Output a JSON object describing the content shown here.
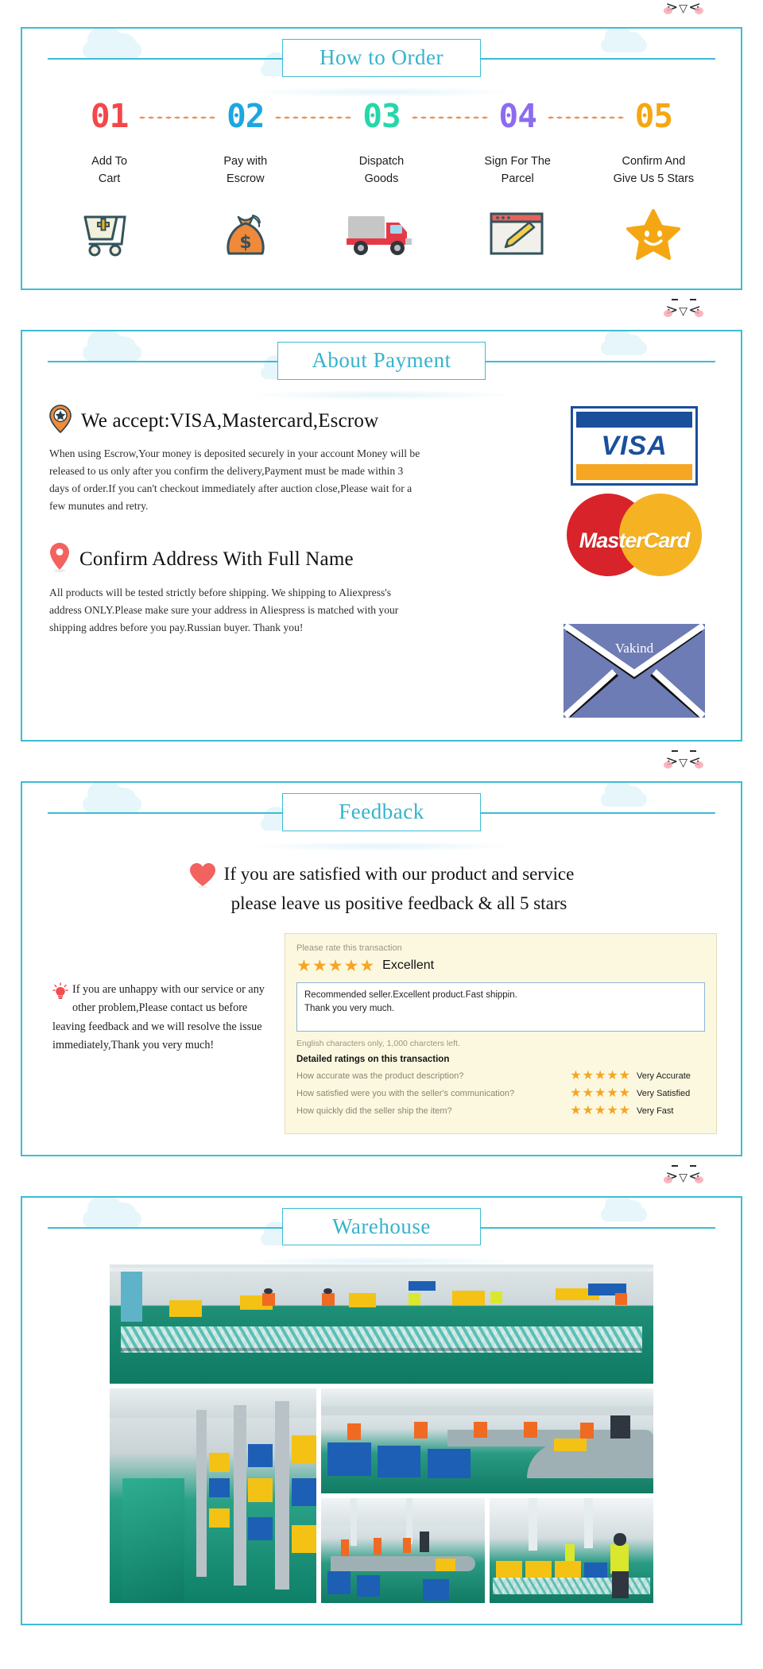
{
  "kaomoji": "⋛⋋ ⋌⋚",
  "sections": {
    "order": {
      "title": "How to Order",
      "steps": [
        {
          "num": "01",
          "color": "#f2484b",
          "label": "Add To\nCart",
          "icon": "shopping-cart-icon"
        },
        {
          "num": "02",
          "color": "#1ca7e0",
          "label": "Pay with\nEscrow",
          "icon": "money-bag-icon"
        },
        {
          "num": "03",
          "color": "#27d6ab",
          "label": "Dispatch\nGoods",
          "icon": "delivery-truck-icon"
        },
        {
          "num": "04",
          "color": "#8b6cf0",
          "label": "Sign For The\nParcel",
          "icon": "sign-document-icon"
        },
        {
          "num": "05",
          "color": "#f5a713",
          "label": "Confirm And\nGive Us 5 Stars",
          "icon": "smiling-star-icon"
        }
      ]
    },
    "payment": {
      "title": "About Payment",
      "block1": {
        "icon": "star-location-pin-icon",
        "heading": "We accept:VISA,Mastercard,Escrow",
        "text": "When using Escrow,Your money is deposited securely in your account Money will be released to us only after you confirm the delivery,Payment must be made within 3 days of order.If you can't checkout immediately after auction close,Please wait for a few munutes and retry."
      },
      "block2": {
        "icon": "location-pin-icon",
        "heading": "Confirm Address With Full Name",
        "text": "All products will be tested strictly before shipping. We shipping to Aliexpress's address ONLY.Please make sure your address in Aliespress is matched with your shipping addres before you pay.Russian buyer. Thank you!"
      },
      "logos": {
        "visa": "VISA",
        "mastercard": "MasterCard",
        "envelope_brand": "Vakind"
      }
    },
    "feedback": {
      "title": "Feedback",
      "heart_icon": "heart-icon",
      "headline_line1": "If you are satisfied with our product and service",
      "headline_line2": "please leave us positive feedback & all 5 stars",
      "bulb_icon": "lightbulb-icon",
      "note": "If you are unhappy with our service or any other problem,Please contact us before leaving feedback and we will resolve the issue immediately,Thank you very much!",
      "rating_card": {
        "prompt": "Please rate this transaction",
        "overall_stars": 5,
        "overall_label": "Excellent",
        "review_line1": "Recommended seller.Excellent product.Fast shippin.",
        "review_line2": "Thank you very much.",
        "char_note": "English characters only, 1,000 charcters left.",
        "detail_title": "Detailed ratings on this transaction",
        "rows": [
          {
            "question": "How accurate was the product description?",
            "stars": 5,
            "value": "Very Accurate"
          },
          {
            "question": "How satisfied were you with the seller's communication?",
            "stars": 5,
            "value": "Very Satisfied"
          },
          {
            "question": "How quickly did the seller ship the item?",
            "stars": 5,
            "value": "Very Fast"
          }
        ]
      }
    },
    "warehouse": {
      "title": "Warehouse",
      "photos": [
        {
          "name": "warehouse-overview-photo",
          "caption": "Warehouse floor with packing stations and expandable conveyors"
        },
        {
          "name": "warehouse-aisle-photo",
          "caption": "Long storage aisle with racking and plastic crates"
        },
        {
          "name": "warehouse-sorting-line-photo",
          "caption": "Sorting line with workers in orange vests and blue bins"
        },
        {
          "name": "warehouse-packing-line-photo",
          "caption": "Packing line with conveyor and blue bins"
        },
        {
          "name": "warehouse-worker-photo",
          "caption": "Worker in yellow vest at yellow crate conveyor"
        }
      ]
    }
  },
  "colors": {
    "accent": "#3dbcd4",
    "title": "#36b3cc",
    "dots": "#f0925a",
    "star": "#f5a623",
    "heart": "#f2625f",
    "visa_blue": "#1a4f9c",
    "visa_gold": "#f5a623",
    "mc_red": "#d8232a",
    "mc_yellow": "#f5b324",
    "envelope": "#6d7cb5",
    "card_bg": "#fcf8e0"
  }
}
